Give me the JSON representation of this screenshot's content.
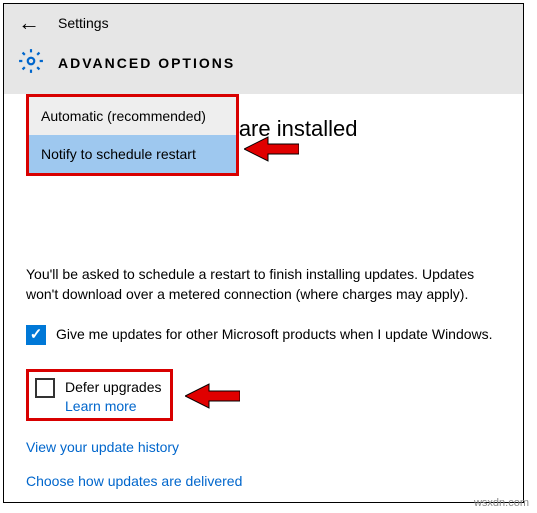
{
  "header": {
    "back_label": "←",
    "settings_label": "Settings",
    "page_title": "ADVANCED OPTIONS"
  },
  "main": {
    "heading_suffix": "s are installed",
    "dropdown": {
      "option_auto": "Automatic (recommended)",
      "option_notify": "Notify to schedule restart"
    },
    "body_text": "You'll be asked to schedule a restart to finish installing updates. Updates won't download over a metered connection (where charges may apply).",
    "checkbox_products": "Give me updates for other Microsoft products when I update Windows.",
    "defer": {
      "label": "Defer upgrades",
      "learn_more": "Learn more"
    },
    "link_history": "View your update history",
    "link_delivery": "Choose how updates are delivered"
  },
  "watermark": "wsxdn.com",
  "colors": {
    "highlight_red": "#d80000",
    "accent_blue": "#0078d7",
    "link_blue": "#0066cc"
  }
}
